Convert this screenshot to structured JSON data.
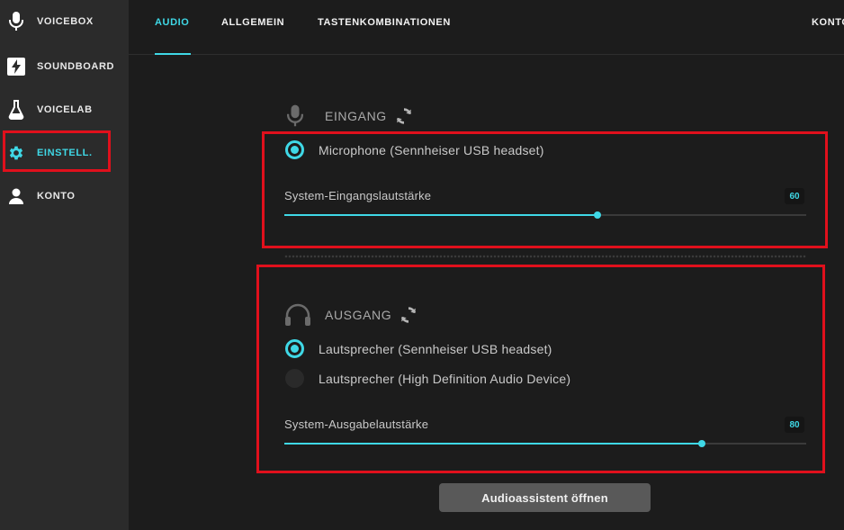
{
  "sidebar": {
    "items": [
      {
        "label": "VOICEBOX",
        "icon": "microphone-icon"
      },
      {
        "label": "SOUNDBOARD",
        "icon": "lightning-icon"
      },
      {
        "label": "VOICELAB",
        "icon": "flask-icon"
      },
      {
        "label": "EINSTELL.",
        "icon": "gear-icon",
        "active": true
      },
      {
        "label": "KONTO",
        "icon": "user-icon"
      }
    ]
  },
  "tabs": [
    {
      "label": "AUDIO",
      "active": true
    },
    {
      "label": "ALLGEMEIN"
    },
    {
      "label": "TASTENKOMBINATIONEN"
    },
    {
      "label": "KONTO"
    }
  ],
  "input": {
    "title": "EINGANG",
    "devices": [
      {
        "label": "Microphone (Sennheiser USB headset)",
        "selected": true
      }
    ],
    "volume_label": "System-Eingangslautstärke",
    "volume": "60"
  },
  "output": {
    "title": "AUSGANG",
    "devices": [
      {
        "label": "Lautsprecher (Sennheiser USB headset)",
        "selected": true
      },
      {
        "label": "Lautsprecher (High Definition Audio Device)",
        "selected": false
      }
    ],
    "volume_label": "System-Ausgabelautstärke",
    "volume": "80"
  },
  "assistant_button": "Audioassistent öffnen",
  "colors": {
    "accent": "#3fd8e6",
    "highlight": "#e0101c",
    "sidebar": "#2b2b2b",
    "background": "#1c1c1c"
  }
}
